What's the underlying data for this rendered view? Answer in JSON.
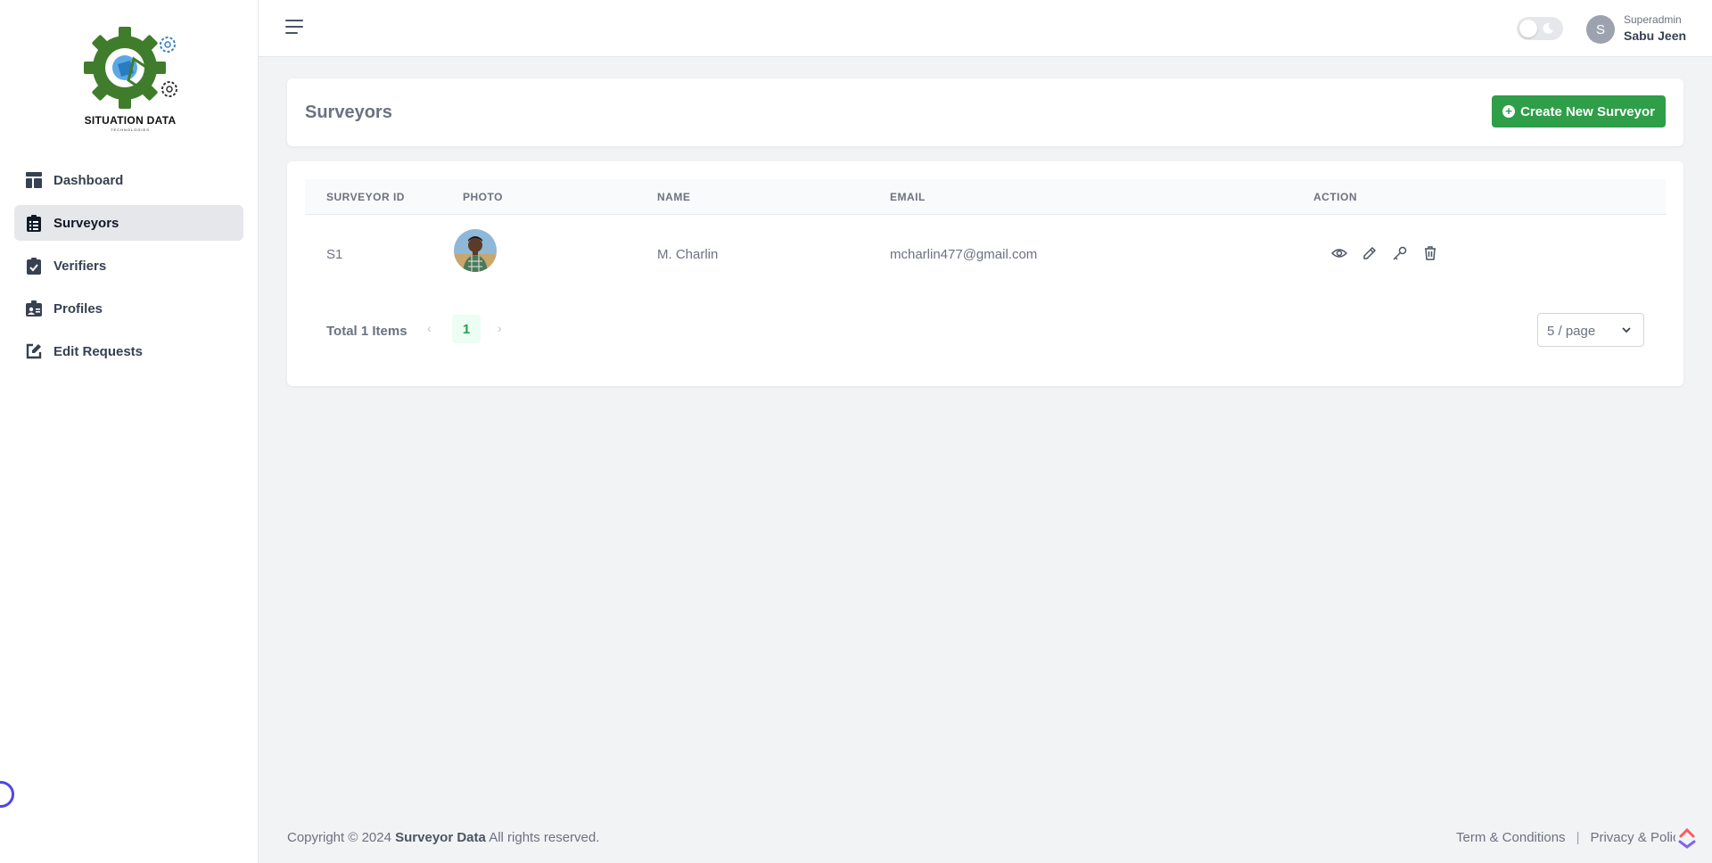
{
  "brand": {
    "logo_text": "SITUATION DATA",
    "logo_subtext": "TECHNOLOGIES"
  },
  "sidebar": {
    "items": [
      {
        "label": "Dashboard",
        "icon": "dashboard-icon",
        "active": false
      },
      {
        "label": "Surveyors",
        "icon": "clipboard-list-icon",
        "active": true
      },
      {
        "label": "Verifiers",
        "icon": "clipboard-check-icon",
        "active": false
      },
      {
        "label": "Profiles",
        "icon": "id-card-icon",
        "active": false
      },
      {
        "label": "Edit Requests",
        "icon": "edit-icon",
        "active": false
      }
    ]
  },
  "topbar": {
    "user_initial": "S",
    "user_role": "Superadmin",
    "user_name": "Sabu Jeen"
  },
  "page": {
    "title": "Surveyors",
    "create_button": "Create New Surveyor"
  },
  "table": {
    "columns": [
      "SURVEYOR ID",
      "PHOTO",
      "NAME",
      "EMAIL",
      "ACTION"
    ],
    "rows": [
      {
        "id": "S1",
        "name": "M. Charlin",
        "email": "mcharlin477@gmail.com"
      }
    ],
    "actions": [
      "view-icon",
      "edit-pencil-icon",
      "key-icon",
      "delete-icon"
    ]
  },
  "pagination": {
    "total": "Total 1 Items",
    "prev": "‹",
    "current_page": "1",
    "next": "›",
    "page_size": "5 / page"
  },
  "footer": {
    "copyright_prefix": "Copyright © 2024",
    "company": "Surveyor Data",
    "rights": "All rights reserved.",
    "terms": "Term & Conditions",
    "separator": "|",
    "privacy": "Privacy & Policy"
  },
  "colors": {
    "primary_green": "#2e9e48",
    "logo_green": "#3f7d2c",
    "accent_blue": "#4f46e5"
  }
}
